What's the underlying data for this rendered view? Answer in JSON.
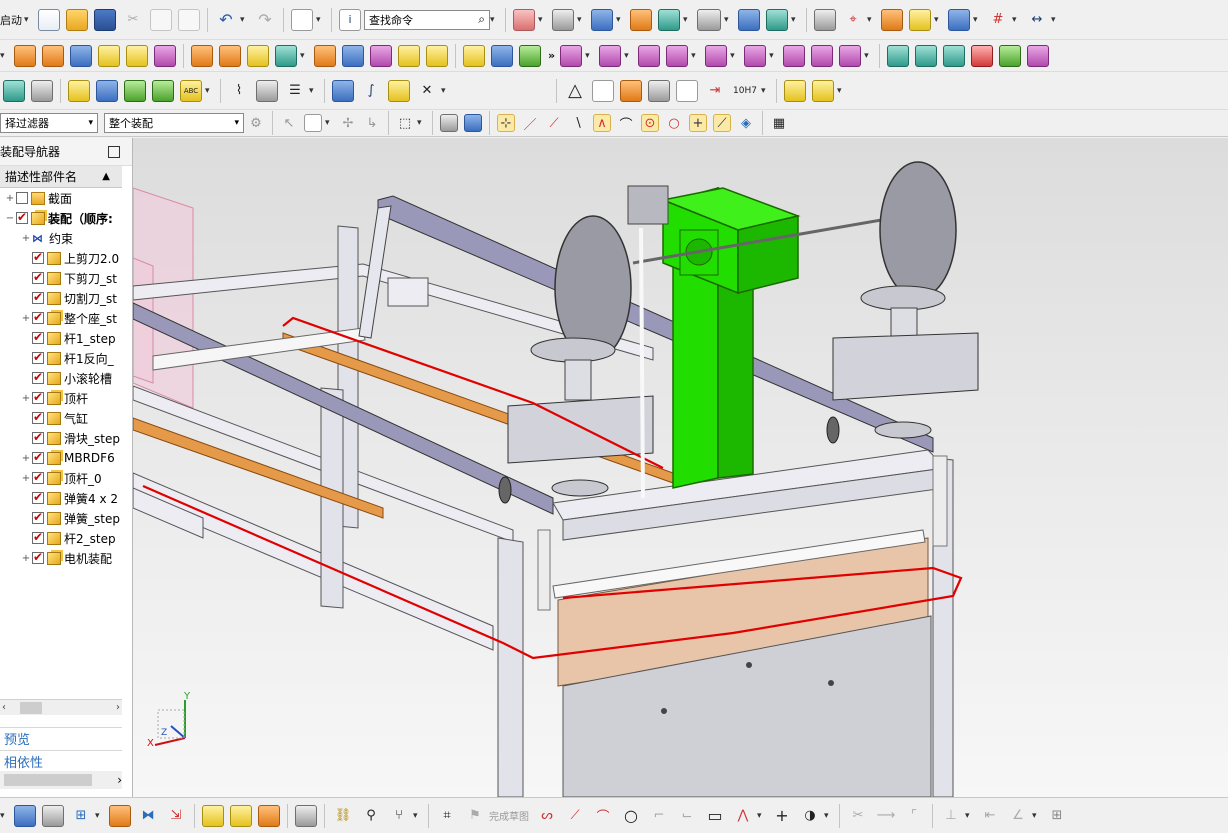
{
  "toolbar": {
    "start_label": "启动",
    "search_placeholder": "查找命令",
    "filter_select": "择过滤器",
    "scope_select": "整个装配",
    "fit_label": "10H7"
  },
  "navigator": {
    "title": "装配导航器",
    "column_header": "描述性部件名",
    "items": [
      {
        "expand": "+",
        "check": false,
        "icon": "folder-icon",
        "label": "截面",
        "bold": false
      },
      {
        "expand": "-",
        "check": true,
        "icon": "assembly-icon",
        "label": "装配（顺序:",
        "bold": true
      },
      {
        "expand": "+",
        "check": null,
        "icon": "constraint-icon",
        "label": "约束",
        "bold": false
      },
      {
        "expand": "",
        "check": true,
        "icon": "part-icon",
        "label": "上剪刀2.0",
        "bold": false
      },
      {
        "expand": "",
        "check": true,
        "icon": "part-icon",
        "label": "下剪刀_st",
        "bold": false
      },
      {
        "expand": "",
        "check": true,
        "icon": "part-icon",
        "label": "切割刀_st",
        "bold": false
      },
      {
        "expand": "+",
        "check": true,
        "icon": "assembly-icon",
        "label": "整个座_st",
        "bold": false
      },
      {
        "expand": "",
        "check": true,
        "icon": "part-icon",
        "label": "杆1_step",
        "bold": false
      },
      {
        "expand": "",
        "check": true,
        "icon": "part-icon",
        "label": "杆1反向_",
        "bold": false
      },
      {
        "expand": "",
        "check": true,
        "icon": "part-icon",
        "label": "小滚轮槽",
        "bold": false
      },
      {
        "expand": "+",
        "check": true,
        "icon": "assembly-icon",
        "label": "顶杆",
        "bold": false
      },
      {
        "expand": "",
        "check": true,
        "icon": "part-icon",
        "label": "气缸",
        "bold": false
      },
      {
        "expand": "",
        "check": true,
        "icon": "part-icon",
        "label": "滑块_step",
        "bold": false
      },
      {
        "expand": "+",
        "check": true,
        "icon": "assembly-icon",
        "label": "MBRDF6",
        "bold": false
      },
      {
        "expand": "+",
        "check": true,
        "icon": "assembly-icon",
        "label": "顶杆_0",
        "bold": false
      },
      {
        "expand": "",
        "check": true,
        "icon": "part-icon",
        "label": "弹簧4 x 2",
        "bold": false
      },
      {
        "expand": "",
        "check": true,
        "icon": "part-icon",
        "label": "弹簧_step",
        "bold": false
      },
      {
        "expand": "",
        "check": true,
        "icon": "part-icon",
        "label": "杆2_step",
        "bold": false
      },
      {
        "expand": "+",
        "check": true,
        "icon": "assembly-icon",
        "label": "电机装配",
        "bold": false
      }
    ],
    "preview_label": "预览",
    "dependency_label": "相依性"
  },
  "bottom_toolbar": {
    "finish_sketch_label": "完成草图"
  },
  "triad": {
    "x": "X",
    "y": "Y",
    "z": "Z"
  },
  "colors": {
    "accent_green": "#22dd00",
    "selection_red": "#e00000",
    "brand_blue": "#2a6ebb"
  }
}
